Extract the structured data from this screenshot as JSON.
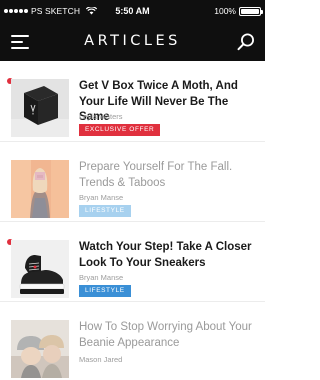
{
  "status_bar": {
    "carrier": "PS SKETCH",
    "time": "5:50 AM",
    "battery_label": "100%",
    "battery_level": 1.0
  },
  "header": {
    "title": "ARTICLES",
    "menu_icon": "hamburger-menu-icon",
    "search_icon": "search-icon"
  },
  "articles": [
    {
      "title": "Get V Box Twice A Moth, And Your Life Will Never Be The Same",
      "author": "Leyla Waters",
      "tag": "EXCLUSIVE OFFER",
      "tag_color": "#e0303e",
      "unread": true,
      "thumb": "v-box-photo"
    },
    {
      "title": "Prepare Yourself For The Fall. Trends & Taboos",
      "author": "Bryan Manse",
      "tag": "LIFESTYLE",
      "tag_color": "#a7d1ef",
      "unread": false,
      "thumb": "fall-fashion-photo"
    },
    {
      "title": "Watch Your Step! Take A Closer Look To Your Sneakers",
      "author": "Bryan Manse",
      "tag": "LIFESTYLE",
      "tag_color": "#3a8fd6",
      "unread": true,
      "thumb": "sneakers-photo"
    },
    {
      "title": "How To Stop Worrying About Your Beanie Appearance",
      "author": "Mason Jared",
      "unread": false,
      "thumb": "beanie-couple-photo"
    }
  ]
}
